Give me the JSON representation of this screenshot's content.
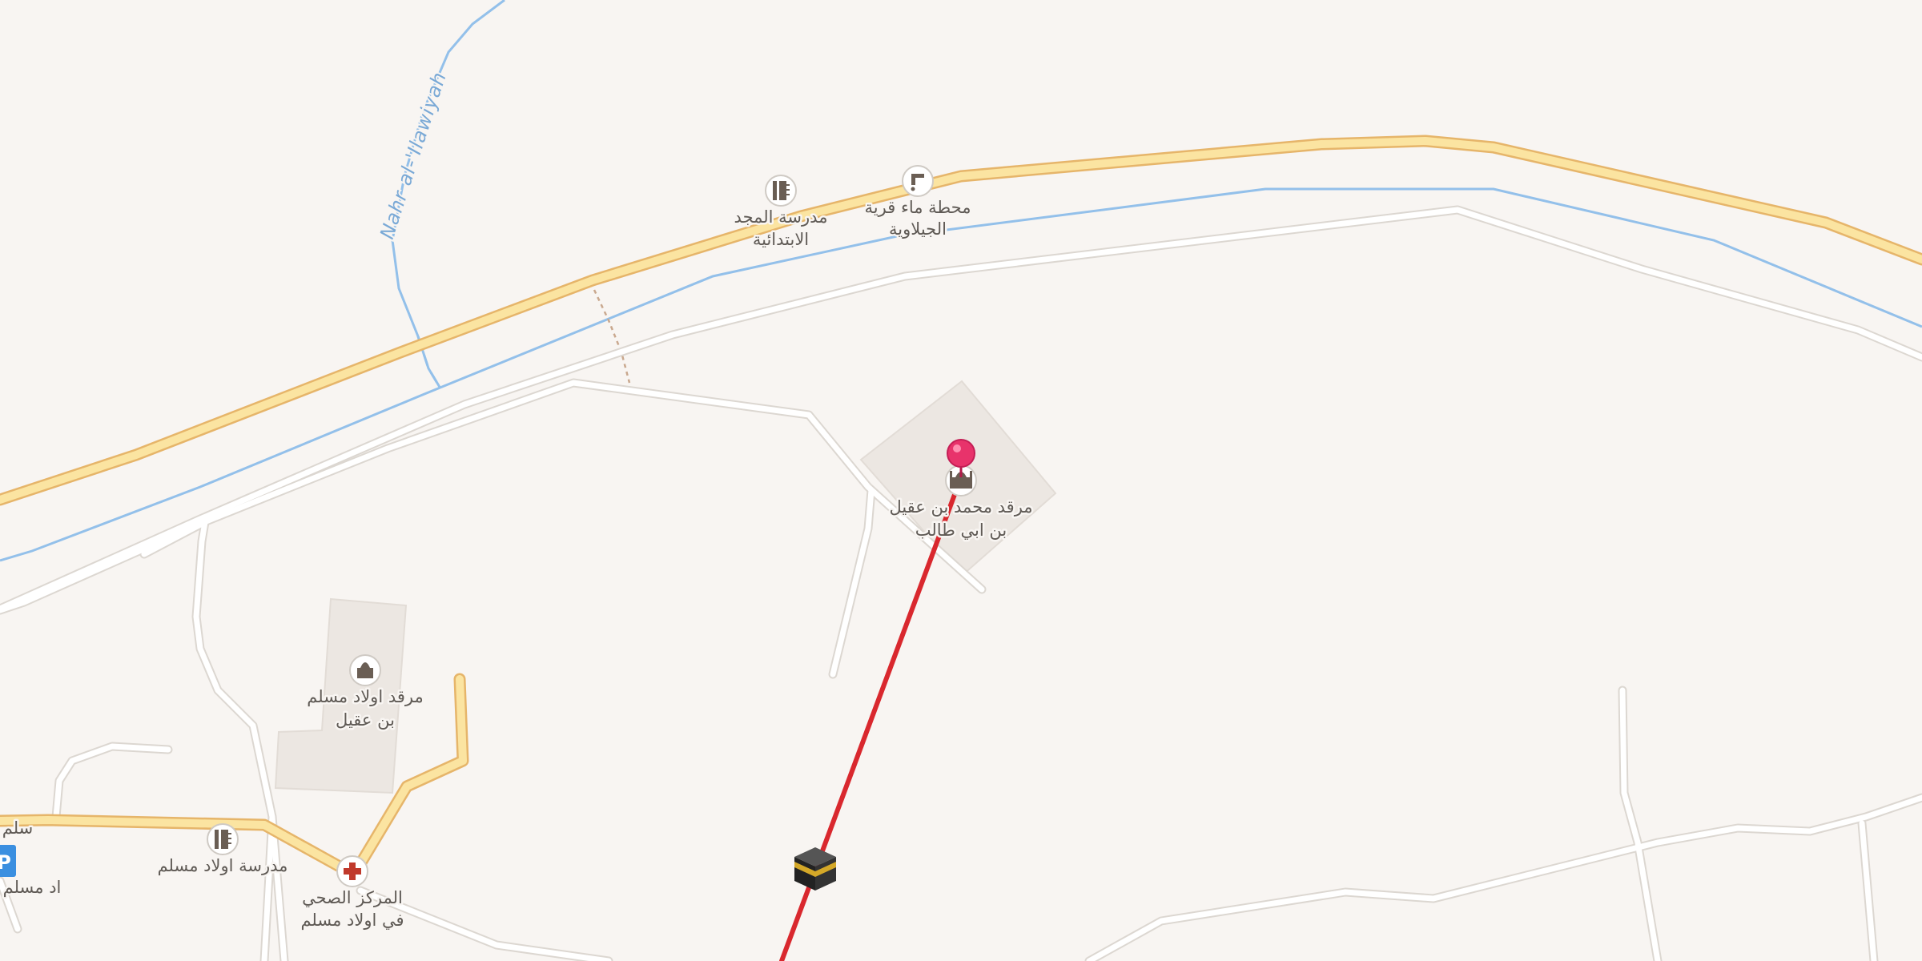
{
  "map": {
    "colors": {
      "background": "#f8f5f2",
      "primary_road": "#fbe4a1",
      "primary_road_casing": "#e6b56a",
      "minor_road": "#ffffff",
      "minor_road_casing": "#dcd7d1",
      "waterway": "#93c0ea",
      "building": "#ece7e2",
      "route": "#d9282e",
      "pin": "#e8336b"
    },
    "waterway_label": "Nahr al-'Ilawiyah",
    "pois": [
      {
        "id": "school-majd",
        "icon": "school-icon",
        "label_line1": "مدرسة المجد",
        "label_line2": "الابتدائية"
      },
      {
        "id": "water-station",
        "icon": "water-tap-icon",
        "label_line1": "محطة ماء قرية",
        "label_line2": "الجيلاوية"
      },
      {
        "id": "shrine-muhammad",
        "icon": "shrine-icon",
        "label_line1": "مرقد محمد بن عقيل",
        "label_line2": "بن ابي طالب"
      },
      {
        "id": "shrine-muslim-sons",
        "icon": "shrine-icon",
        "label_line1": "مرقد اولاد مسلم",
        "label_line2": "بن عقيل"
      },
      {
        "id": "school-muslim-sons",
        "icon": "school-icon",
        "label_line1": "مدرسة اولاد مسلم",
        "label_line2": ""
      },
      {
        "id": "health-center",
        "icon": "medical-cross-icon",
        "label_line1": "المركز الصحي",
        "label_line2": "في اولاد مسلم"
      }
    ],
    "edge_labels": {
      "left_top": "سلم",
      "left_bottom": "اد مسلم"
    },
    "parking_icon": "P",
    "qibla_icon": "kaaba-icon"
  }
}
